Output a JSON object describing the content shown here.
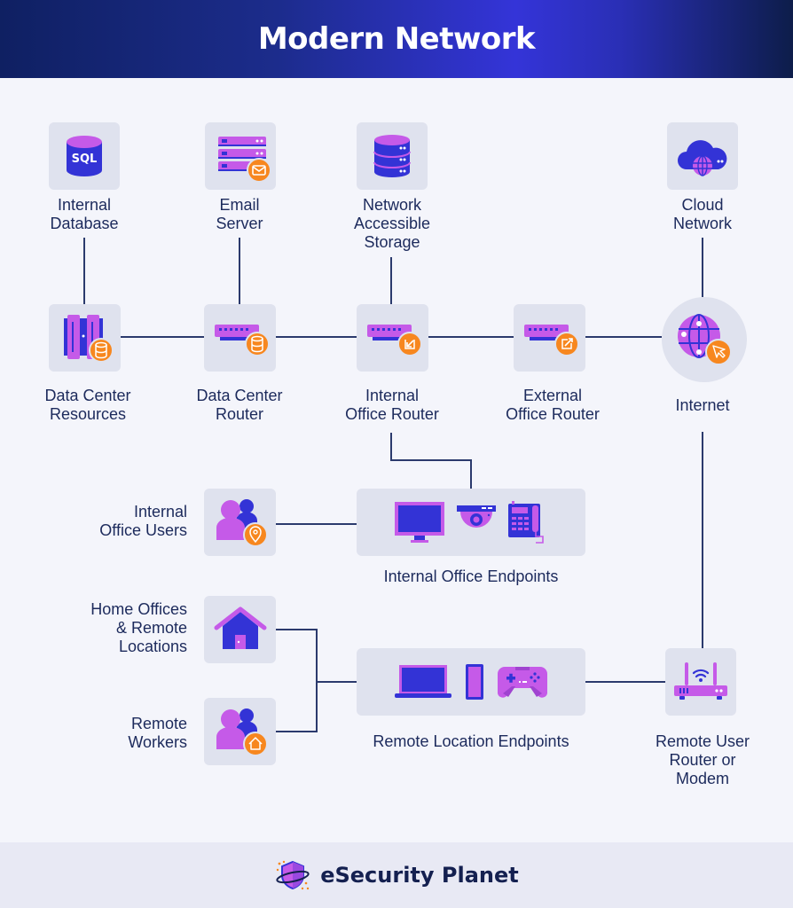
{
  "header": {
    "title": "Modern Network"
  },
  "colors": {
    "header_start": "#0f2062",
    "header_mid": "#3434d8",
    "tile_bg": "#dfe2ee",
    "page_bg": "#f4f5fb",
    "line": "#2b3a6d",
    "accent_purple": "#c55ae8",
    "accent_blue": "#3333d6",
    "badge_orange": "#f7871f",
    "text": "#1c2a5c"
  },
  "nodes": {
    "internal_database": {
      "label": "Internal\nDatabase",
      "icon": "sql-database-icon",
      "icon_text": "SQL"
    },
    "email_server": {
      "label": "Email\nServer",
      "icon": "server-rack-icon",
      "badge": "envelope-icon"
    },
    "network_storage": {
      "label": "Network\nAccessible\nStorage",
      "icon": "storage-stack-icon"
    },
    "cloud_network": {
      "label": "Cloud\nNetwork",
      "icon": "cloud-globe-icon"
    },
    "data_center_resources": {
      "label": "Data Center\nResources",
      "icon": "server-cabinet-icon",
      "badge": "database-icon"
    },
    "data_center_router": {
      "label": "Data Center\nRouter",
      "icon": "switch-icon",
      "badge": "database-icon"
    },
    "internal_office_router": {
      "label": "Internal\nOffice Router",
      "icon": "switch-icon",
      "badge": "arrow-in-icon"
    },
    "external_office_router": {
      "label": "External\nOffice Router",
      "icon": "switch-icon",
      "badge": "arrow-out-icon"
    },
    "internet": {
      "label": "Internet",
      "icon": "globe-icon",
      "badge": "cursor-icon"
    },
    "internal_office_users": {
      "label": "Internal\nOffice Users",
      "icon": "users-icon",
      "badge": "location-pin-icon"
    },
    "internal_office_endpoints": {
      "label": "Internal Office Endpoints",
      "icons": [
        "monitor-icon",
        "security-camera-icon",
        "desk-phone-icon"
      ]
    },
    "home_offices": {
      "label": "Home Offices\n& Remote\nLocations",
      "icon": "house-icon"
    },
    "remote_workers": {
      "label": "Remote\nWorkers",
      "icon": "users-icon",
      "badge": "home-icon"
    },
    "remote_location_endpoints": {
      "label": "Remote Location Endpoints",
      "icons": [
        "laptop-icon",
        "smartphone-icon",
        "gamepad-icon"
      ]
    },
    "remote_user_router": {
      "label": "Remote User\nRouter or\nModem",
      "icon": "wifi-router-icon"
    }
  },
  "footer": {
    "brand": "eSecurity Planet",
    "logo": "shield-planet-logo"
  }
}
